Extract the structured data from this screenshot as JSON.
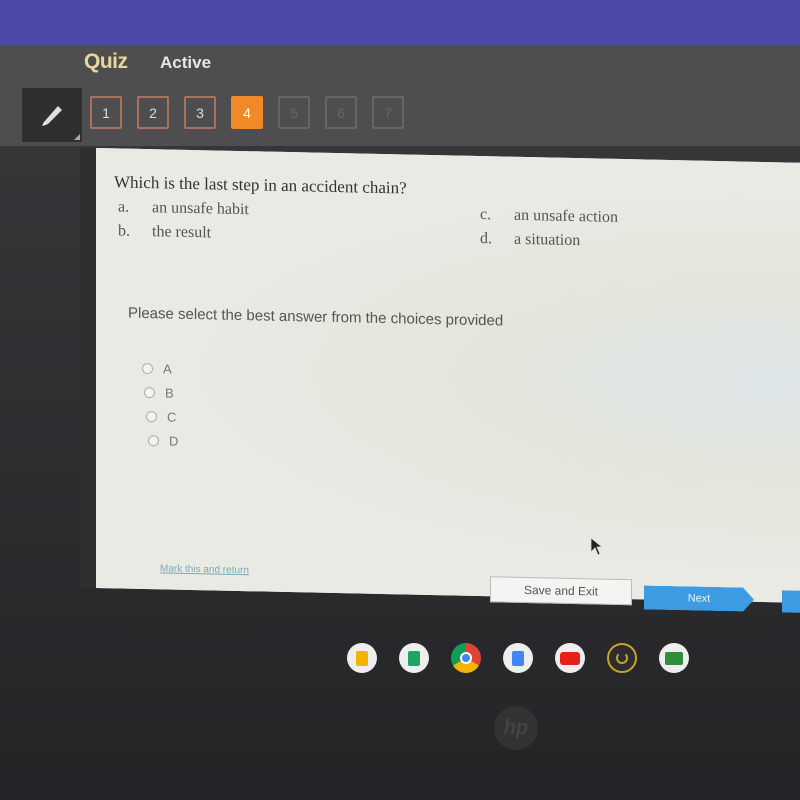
{
  "header": {
    "title": "Quiz",
    "status": "Active"
  },
  "question_nav": {
    "items": [
      {
        "label": "1",
        "state": "answered"
      },
      {
        "label": "2",
        "state": "answered"
      },
      {
        "label": "3",
        "state": "answered"
      },
      {
        "label": "4",
        "state": "current"
      },
      {
        "label": "5",
        "state": "locked"
      },
      {
        "label": "6",
        "state": "locked"
      },
      {
        "label": "7",
        "state": "locked"
      }
    ],
    "current": 4
  },
  "question": {
    "text": "Which is the last step in an accident chain?",
    "choices": [
      {
        "letter": "a.",
        "text": "an unsafe habit"
      },
      {
        "letter": "b.",
        "text": "the result"
      },
      {
        "letter": "c.",
        "text": "an unsafe action"
      },
      {
        "letter": "d.",
        "text": "a situation"
      }
    ]
  },
  "answer": {
    "instruction": "Please select the best answer from the choices provided",
    "options": [
      "A",
      "B",
      "C",
      "D"
    ],
    "selected": null
  },
  "footer": {
    "mark_link": "Mark this and return",
    "save_label": "Save and Exit",
    "next_label": "Next"
  },
  "shelf": {
    "apps": [
      "slides-icon",
      "sheets-icon",
      "chrome-icon",
      "docs-icon",
      "youtube-icon",
      "power-icon",
      "classroom-icon"
    ]
  },
  "colors": {
    "topbar": "#4b4aa8",
    "active_question": "#f08a26",
    "next_button": "#3d9be3",
    "quiz_title": "#e8d79a"
  }
}
